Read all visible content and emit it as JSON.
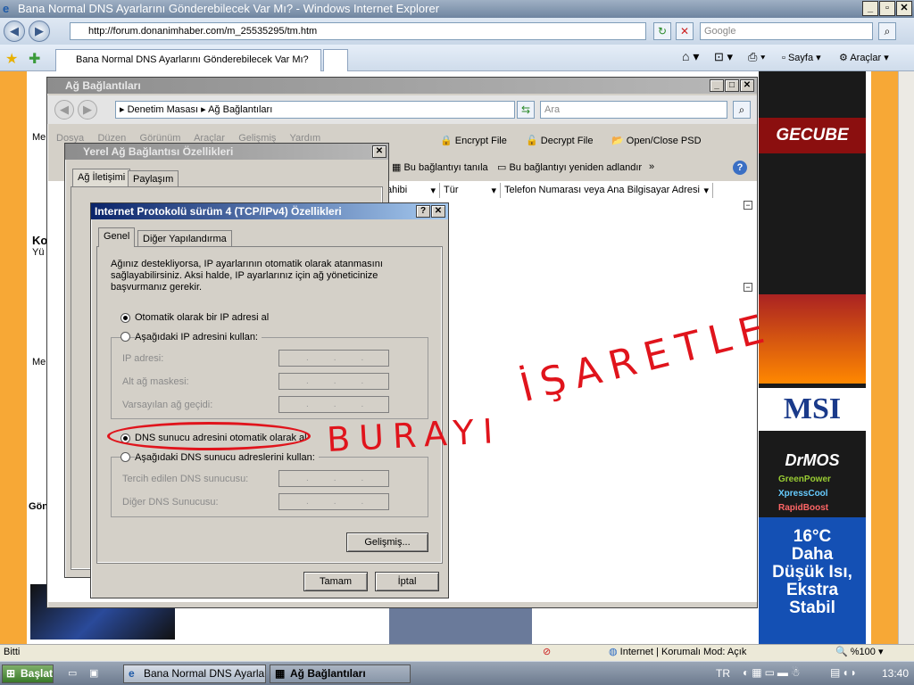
{
  "browser": {
    "title": "Bana Normal DNS Ayarlarını Gönderebilecek Var Mı? - Windows Internet Explorer",
    "url": "http://forum.donanimhaber.com/m_25535295/tm.htm",
    "search_placeholder": "Google",
    "tab_title": "Bana Normal DNS Ayarlarını Gönderebilecek Var Mı?",
    "cmd_page": "Sayfa",
    "cmd_tools": "Araçlar"
  },
  "netconn": {
    "title": "Ağ Bağlantıları",
    "breadcrumb_1": "Denetim Masası",
    "breadcrumb_2": "Ağ Bağlantıları",
    "search_placeholder": "Ara",
    "menu": [
      "Dosya",
      "Düzen",
      "Görünüm",
      "Araçlar",
      "Gelişmiş",
      "Yardım"
    ],
    "encrypt": "Encrypt File",
    "decrypt": "Decrypt File",
    "openclose": "Open/Close PSD",
    "diagnose": "Bu bağlantıyı tanıla",
    "rename": "Bu bağlantıyı yeniden adlandır",
    "more": "»",
    "col_owner": "ahibi",
    "col_type": "Tür",
    "col_phone": "Telefon Numarası veya Ana Bilgisayar Adresi"
  },
  "lan": {
    "title": "Yerel Ağ Bağlantısı Özellikleri",
    "tab_network": "Ağ İletişimi",
    "tab_sharing": "Paylaşım"
  },
  "ipv4": {
    "title": "Internet Protokolü sürüm 4 (TCP/IPv4) Özellikleri",
    "tab_general": "Genel",
    "tab_alt": "Diğer Yapılandırma",
    "description": "Ağınız destekliyorsa, IP ayarlarının otomatik olarak atanmasını sağlayabilirsiniz. Aksi halde, IP ayarlarınız için ağ yöneticinize başvurmanız gerekir.",
    "auto_ip": "Otomatik olarak bir IP adresi al",
    "manual_ip": "Aşağıdaki IP adresini kullan:",
    "ip_label": "IP adresi:",
    "mask_label": "Alt ağ maskesi:",
    "gateway_label": "Varsayılan ağ geçidi:",
    "auto_dns": "DNS sunucu adresini otomatik olarak al",
    "manual_dns": "Aşağıdaki DNS sunucu adreslerini kullan:",
    "pref_dns": "Tercih edilen DNS sunucusu:",
    "alt_dns": "Diğer DNS Sunucusu:",
    "advanced": "Gelişmiş...",
    "ok": "Tamam",
    "cancel": "İptal"
  },
  "annotation": {
    "text_1": "BURAYI",
    "text_2": "İŞARETLE"
  },
  "page_fragments": {
    "me1": "Me",
    "ko": "Ko",
    "yu": "Yü",
    "me2": "Me",
    "gon": "Gön"
  },
  "ads": {
    "gecube": "GECUBE",
    "msi": "MSI",
    "drmos": "DrMOS",
    "green": "GreenPower",
    "xpress": "XpressCool",
    "rapid": "RapidBoost",
    "promo_1": "16°C",
    "promo_2": "Daha",
    "promo_3": "Düşük Isı,",
    "promo_4": "Ekstra",
    "promo_5": "Stabil"
  },
  "status": {
    "text": "Bitti",
    "zone": "Internet | Korumalı Mod: Açık",
    "zoom": "%100"
  },
  "taskbar": {
    "start": "Başlat",
    "item1": "Bana Normal DNS Ayarlar...",
    "item2": "Ağ Bağlantıları",
    "lang": "TR",
    "clock": "13:40"
  },
  "colors": {
    "annotation": "#e0141c",
    "accent": "#0a246a",
    "page_side": "#f7a836"
  }
}
